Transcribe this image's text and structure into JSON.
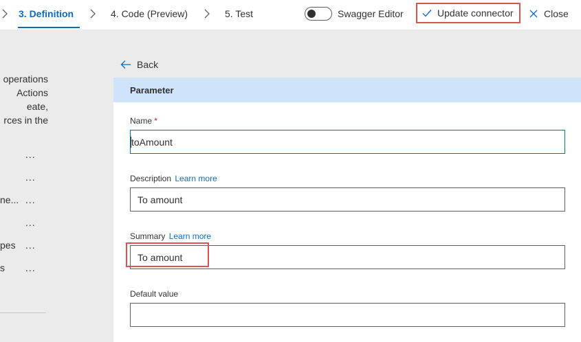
{
  "steps": [
    {
      "label": "3. Definition",
      "active": true
    },
    {
      "label": "4. Code (Preview)",
      "active": false
    },
    {
      "label": "5. Test",
      "active": false
    }
  ],
  "toolbar": {
    "swagger_label": "Swagger Editor",
    "swagger_enabled": false,
    "update_label": "Update connector",
    "close_label": "Close"
  },
  "left_panel": {
    "description_lines": [
      "operations",
      "Actions",
      "eate,",
      "rces in the"
    ],
    "items": [
      {
        "label": "",
        "more": "..."
      },
      {
        "label": "",
        "more": "..."
      },
      {
        "label": "ne...",
        "more": "..."
      },
      {
        "label": "",
        "more": "..."
      },
      {
        "label": "pes",
        "more": "..."
      },
      {
        "label": "s",
        "more": "..."
      }
    ]
  },
  "form": {
    "back_label": "Back",
    "section_title": "Parameter",
    "name": {
      "label": "Name",
      "required_mark": "*",
      "value": "toAmount"
    },
    "description": {
      "label": "Description",
      "link": "Learn more",
      "value": "To amount"
    },
    "summary": {
      "label": "Summary",
      "link": "Learn more",
      "value": "To amount"
    },
    "default_value": {
      "label": "Default value",
      "value": ""
    }
  },
  "colors": {
    "accent": "#0f6cbd",
    "highlight": "#d9534f",
    "section_header_bg": "#cfe3fb",
    "panel_bg": "#ebebeb"
  }
}
